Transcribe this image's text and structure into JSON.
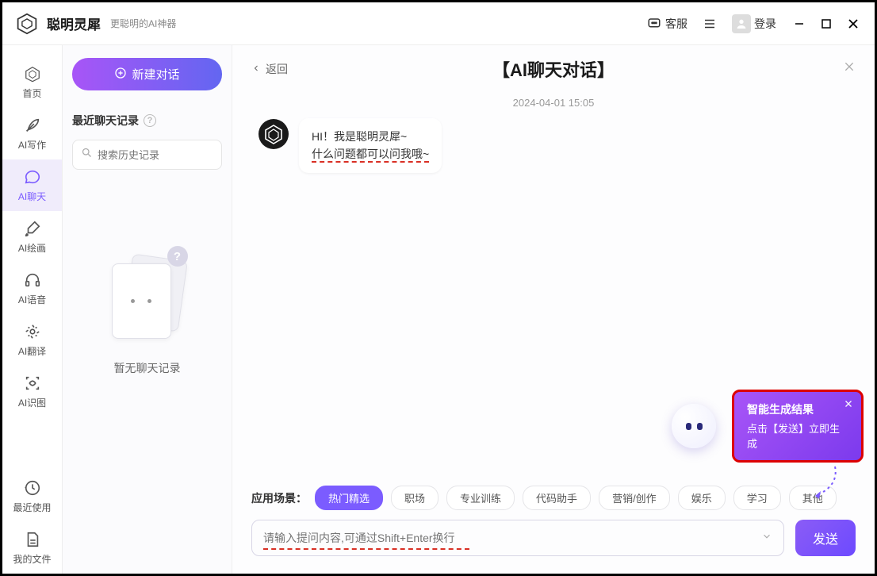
{
  "header": {
    "app_name": "聪明灵犀",
    "tagline": "更聪明的AI神器",
    "support": "客服",
    "login": "登录"
  },
  "sidebar": {
    "items": [
      {
        "label": "首页"
      },
      {
        "label": "AI写作"
      },
      {
        "label": "AI聊天"
      },
      {
        "label": "AI绘画"
      },
      {
        "label": "AI语音"
      },
      {
        "label": "AI翻译"
      },
      {
        "label": "AI识图"
      },
      {
        "label": "最近使用"
      },
      {
        "label": "我的文件"
      }
    ]
  },
  "history": {
    "new_chat": "新建对话",
    "title": "最近聊天记录",
    "search_placeholder": "搜索历史记录",
    "empty": "暂无聊天记录"
  },
  "main": {
    "back": "返回",
    "title": "【AI聊天对话】",
    "timestamp": "2024-04-01 15:05",
    "greeting_line1": "HI！我是聪明灵犀~",
    "greeting_line2": "什么问题都可以问我哦~",
    "tooltip_title": "智能生成结果",
    "tooltip_sub": "点击【发送】立即生成",
    "scenario_label": "应用场景：",
    "chips": [
      "热门精选",
      "职场",
      "专业训练",
      "代码助手",
      "营销/创作",
      "娱乐",
      "学习",
      "其他"
    ],
    "input_placeholder": "请输入提问内容,可通过Shift+Enter换行",
    "send": "发送"
  }
}
